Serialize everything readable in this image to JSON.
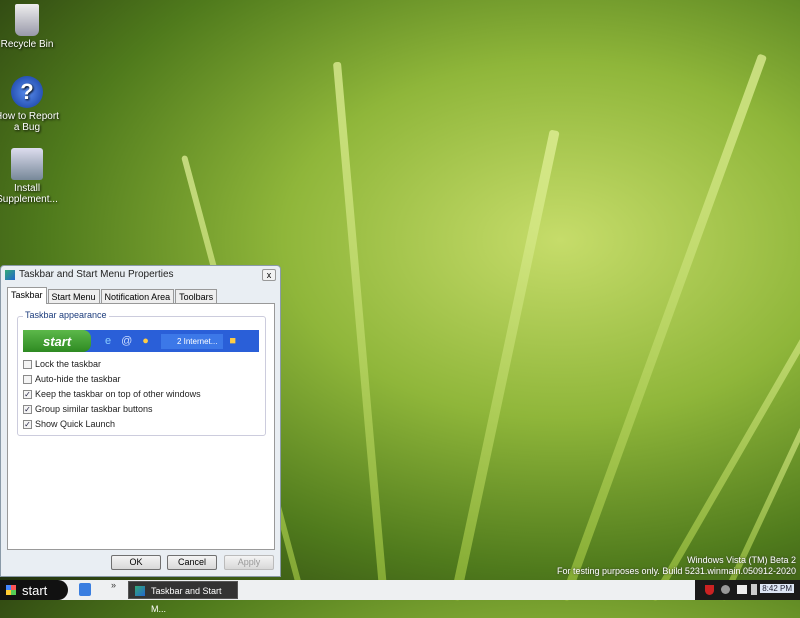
{
  "desktop": {
    "icons": [
      {
        "label": "Recycle Bin"
      },
      {
        "label": "How to Report a Bug"
      },
      {
        "label": "Install Supplement..."
      }
    ],
    "watermark": {
      "line1": "Windows Vista (TM) Beta 2",
      "line2": "For testing purposes only. Build 5231.winmain.050912-2020"
    }
  },
  "dialog": {
    "title": "Taskbar and Start Menu Properties",
    "close": "x",
    "tabs": [
      {
        "label": "Taskbar"
      },
      {
        "label": "Start Menu"
      },
      {
        "label": "Notification Area"
      },
      {
        "label": "Toolbars"
      }
    ],
    "group_label": "Taskbar appearance",
    "preview": {
      "start": "start",
      "window": "2 Internet..."
    },
    "options": [
      {
        "label": "Lock the taskbar",
        "checked": false
      },
      {
        "label": "Auto-hide the taskbar",
        "checked": false
      },
      {
        "label": "Keep the taskbar on top of other windows",
        "checked": true
      },
      {
        "label": "Group similar taskbar buttons",
        "checked": true
      },
      {
        "label": "Show Quick Launch",
        "checked": true
      }
    ],
    "buttons": {
      "ok": "OK",
      "cancel": "Cancel",
      "apply": "Apply"
    }
  },
  "taskbar": {
    "start": "start",
    "chevron": "»",
    "task": "Taskbar and Start M...",
    "clock": "8:42 PM"
  }
}
